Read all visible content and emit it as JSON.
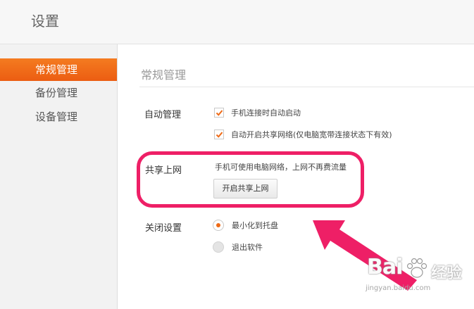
{
  "window": {
    "title": "设置"
  },
  "sidebar": {
    "items": [
      {
        "label": "常规管理",
        "active": true
      },
      {
        "label": "备份管理",
        "active": false
      },
      {
        "label": "设备管理",
        "active": false
      }
    ]
  },
  "main": {
    "section_title": "常规管理",
    "autostart": {
      "label": "自动管理",
      "options": [
        {
          "label": "手机连接时自动启动",
          "checked": true
        },
        {
          "label": "自动开启共享网络(仅电脑宽带连接状态下有效)",
          "checked": true
        }
      ]
    },
    "share": {
      "label": "共享上网",
      "description": "手机可使用电脑网络，上网不再费流量",
      "button_label": "开启共享上网"
    },
    "close": {
      "label": "关闭设置",
      "options": [
        {
          "label": "最小化到托盘",
          "selected": true
        },
        {
          "label": "退出软件",
          "selected": false
        }
      ]
    }
  },
  "watermark": {
    "logo": "Bai",
    "jingyan": "经验",
    "url": "jingyan.baidu.com"
  },
  "colors": {
    "accent": "#f47b20",
    "highlight": "#ee1f66",
    "check": "#ee6a16"
  }
}
